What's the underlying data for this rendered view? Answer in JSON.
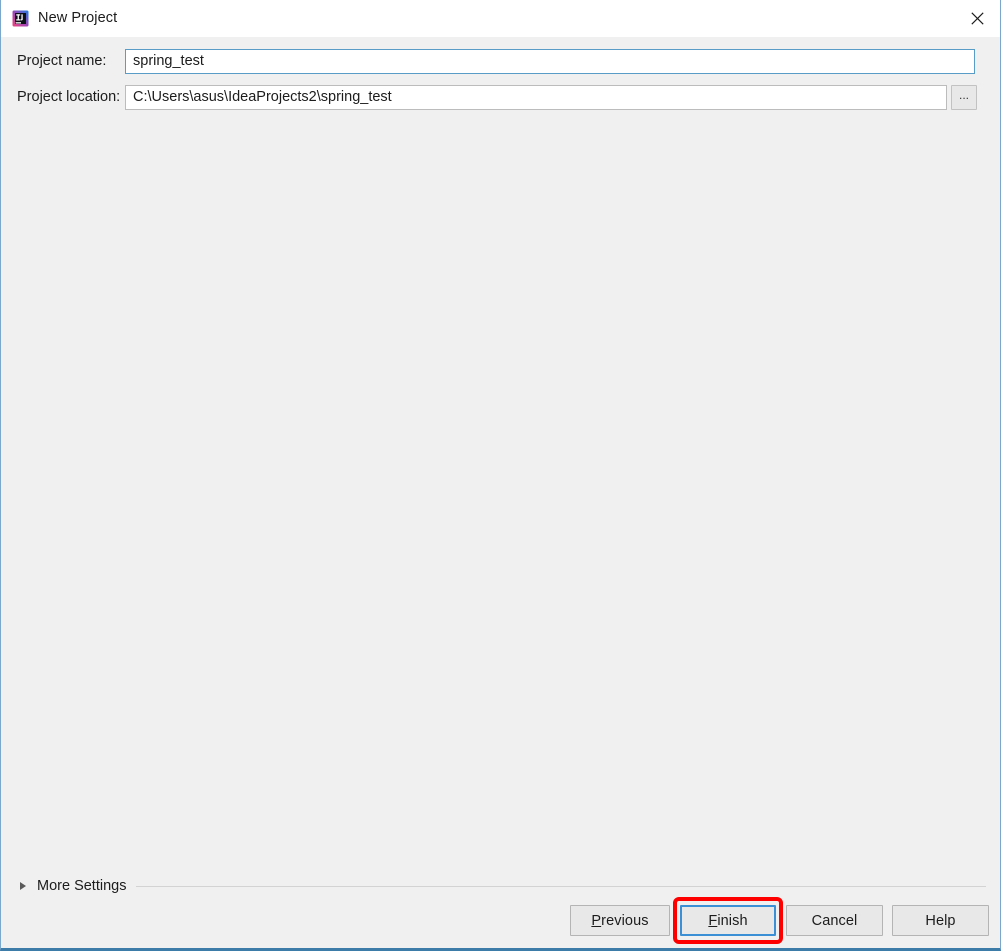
{
  "window": {
    "title": "New Project",
    "app_icon": "intellij-idea-icon",
    "close_icon": "close-icon",
    "background_color": "#f0f0f0",
    "titlebar_color": "#ffffff",
    "border_color": "#3d7ba8"
  },
  "form": {
    "fields": [
      {
        "label": "Project name:",
        "value": "spring_test",
        "placeholder": "",
        "focused": true,
        "has_browse_button": false
      },
      {
        "label": "Project location:",
        "value": "C:\\Users\\asus\\IdeaProjects2\\spring_test",
        "placeholder": "",
        "focused": false,
        "has_browse_button": true,
        "browse_label": "..."
      }
    ]
  },
  "more_settings": {
    "label": "More Settings",
    "expanded": false,
    "disclosure_icon": "chevron-right-icon"
  },
  "footer": {
    "buttons": [
      {
        "label": "Previous",
        "mnemonic": "P",
        "default": false,
        "highlighted": false
      },
      {
        "label": "Finish",
        "mnemonic": "F",
        "default": true,
        "highlighted": true
      },
      {
        "label": "Cancel",
        "mnemonic": "",
        "default": false,
        "highlighted": false
      },
      {
        "label": "Help",
        "mnemonic": "",
        "default": false,
        "highlighted": false
      }
    ]
  },
  "annotation": {
    "target": "Finish",
    "color": "#fe0000",
    "shape": "rounded-rectangle"
  },
  "colors": {
    "accent": "#3b8fd4",
    "annotation": "#fe0000",
    "window_border": "#3d7ba8",
    "body_bg": "#f0f0f0",
    "input_bg": "#ffffff",
    "button_bg": "#e8e8e8",
    "text": "#1c1c1c"
  }
}
